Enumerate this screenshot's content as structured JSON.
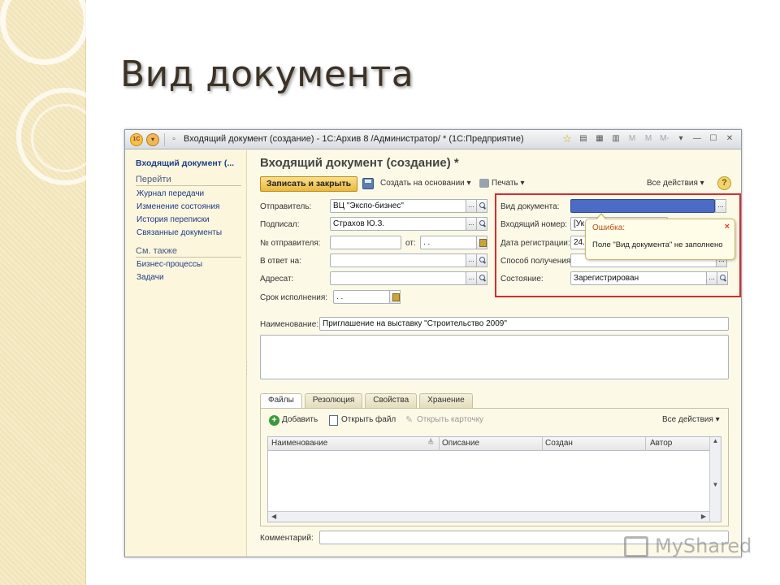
{
  "slide": {
    "title": "Вид документа"
  },
  "window": {
    "title": "Входящий документ (создание) - 1С:Архив 8 /Администратор/ * (1С:Предприятие)"
  },
  "left_panel": {
    "header": "Входящий документ (...",
    "section_goto": "Перейти",
    "goto_links": [
      "Журнал передачи",
      "Изменение состояния",
      "История переписки",
      "Связанные документы"
    ],
    "section_see_also": "См. также",
    "see_also_links": [
      "Бизнес-процессы",
      "Задачи"
    ]
  },
  "form": {
    "title": "Входящий документ (создание) *",
    "toolbar": {
      "save_close": "Записать и закрыть",
      "create_based": "Создать на основании ▾",
      "print": "Печать ▾",
      "all_actions": "Все действия ▾",
      "help": "?"
    },
    "fields": {
      "sender_label": "Отправитель:",
      "sender_value": "ВЦ \"Экспо-бизнес\"",
      "signed_label": "Подписал:",
      "signed_value": "Страхов Ю.З.",
      "sender_no_label": "№ отправителя:",
      "sender_no_value": "",
      "from_label": "от:",
      "from_value": " .  .",
      "reply_label": "В ответ на:",
      "reply_value": "",
      "addressee_label": "Адресат:",
      "addressee_value": "",
      "deadline_label": "Срок исполнения:",
      "deadline_value": " .  .",
      "doc_type_label": "Вид документа:",
      "incoming_no_label": "Входящий номер:",
      "incoming_no_value": "[Ук",
      "reg_date_label": "Дата регистрации:",
      "reg_date_value": "24.0",
      "receive_method_label": "Способ получения:",
      "receive_method_value": "",
      "state_label": "Состояние:",
      "state_value": "Зарегистрирован",
      "name_label": "Наименование:",
      "name_value": "Приглашение на выставку \"Строительство 2009\"",
      "comment_label": "Комментарий:",
      "comment_value": ""
    },
    "error": {
      "title": "Ошибка:",
      "message": "Поле \"Вид документа\" не заполнено",
      "close": "×"
    },
    "tabs": [
      "Файлы",
      "Резолюция",
      "Свойства",
      "Хранение"
    ],
    "files_toolbar": {
      "add": "Добавить",
      "open_file": "Открыть файл",
      "open_card": "Открыть карточку",
      "all_actions": "Все действия ▾"
    },
    "grid_columns": [
      "Наименование",
      "Описание",
      "Создан",
      "Автор"
    ]
  },
  "watermark": "MyShared"
}
